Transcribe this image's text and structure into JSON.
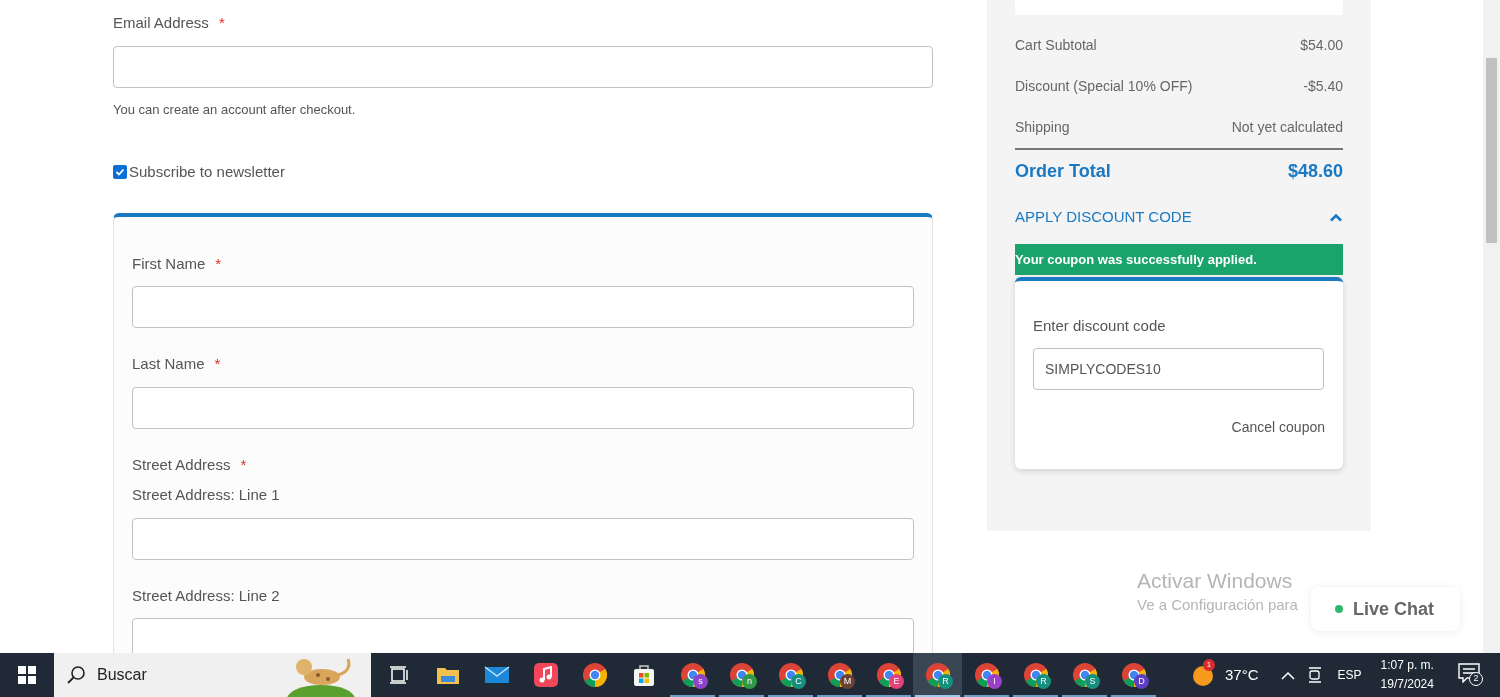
{
  "email": {
    "label": "Email Address",
    "required": "*",
    "note": "You can create an account after checkout."
  },
  "newsletter": {
    "label": "Subscribe to newsletter",
    "checked": true
  },
  "address_form": {
    "fields": [
      {
        "kind": "field",
        "label": "First Name",
        "required": "*"
      },
      {
        "kind": "field",
        "label": "Last Name",
        "required": "*"
      },
      {
        "kind": "group",
        "label": "Street Address",
        "required": "*",
        "sublabel": "Street Address: Line 1"
      },
      {
        "kind": "field",
        "label": "Street Address: Line 2"
      }
    ]
  },
  "summary": {
    "rows": [
      {
        "label": "Cart Subtotal",
        "value": "$54.00"
      },
      {
        "label": "Discount (Special 10% OFF)",
        "value": "-$5.40"
      },
      {
        "label": "Shipping",
        "value": "Not yet calculated"
      }
    ],
    "total": {
      "label": "Order Total",
      "value": "$48.60"
    },
    "discount": {
      "toggle": "APPLY DISCOUNT CODE",
      "expanded": true,
      "message": "Your coupon was successfully applied.",
      "label": "Enter discount code",
      "value": "SIMPLYCODES10",
      "cancel": "Cancel coupon"
    }
  },
  "windows_notice": {
    "title": "Activar Windows",
    "text": "Ve a Configuración para"
  },
  "live_chat": {
    "label": "Live Chat"
  },
  "taskbar": {
    "search": "Buscar",
    "apps": [
      {
        "kind": "taskview"
      },
      {
        "kind": "folder"
      },
      {
        "kind": "mail"
      },
      {
        "kind": "music"
      },
      {
        "kind": "chrome"
      },
      {
        "kind": "store"
      },
      {
        "kind": "profile",
        "letter": "s",
        "color": "#8e44c8",
        "selected": false
      },
      {
        "kind": "profile",
        "letter": "n",
        "color": "#2e9a48",
        "selected": false
      },
      {
        "kind": "profile",
        "letter": "C",
        "color": "#16907e",
        "selected": false
      },
      {
        "kind": "profile",
        "letter": "M",
        "color": "#6b4232",
        "selected": false
      },
      {
        "kind": "profile",
        "letter": "E",
        "color": "#e4407a",
        "selected": false
      },
      {
        "kind": "profile",
        "letter": "R",
        "color": "#16907e",
        "selected": true
      },
      {
        "kind": "profile",
        "letter": "I",
        "color": "#9b3fc8",
        "selected": false
      },
      {
        "kind": "profile",
        "letter": "R",
        "color": "#16907e",
        "selected": false
      },
      {
        "kind": "profile",
        "letter": "S",
        "color": "#16907e",
        "selected": false
      },
      {
        "kind": "profile",
        "letter": "D",
        "color": "#5a3fc0",
        "selected": false
      }
    ],
    "weather_badge": "1",
    "temperature": "37°C",
    "language": "ESP",
    "time": "1:07 p. m.",
    "date": "19/7/2024",
    "notifications": "2"
  }
}
